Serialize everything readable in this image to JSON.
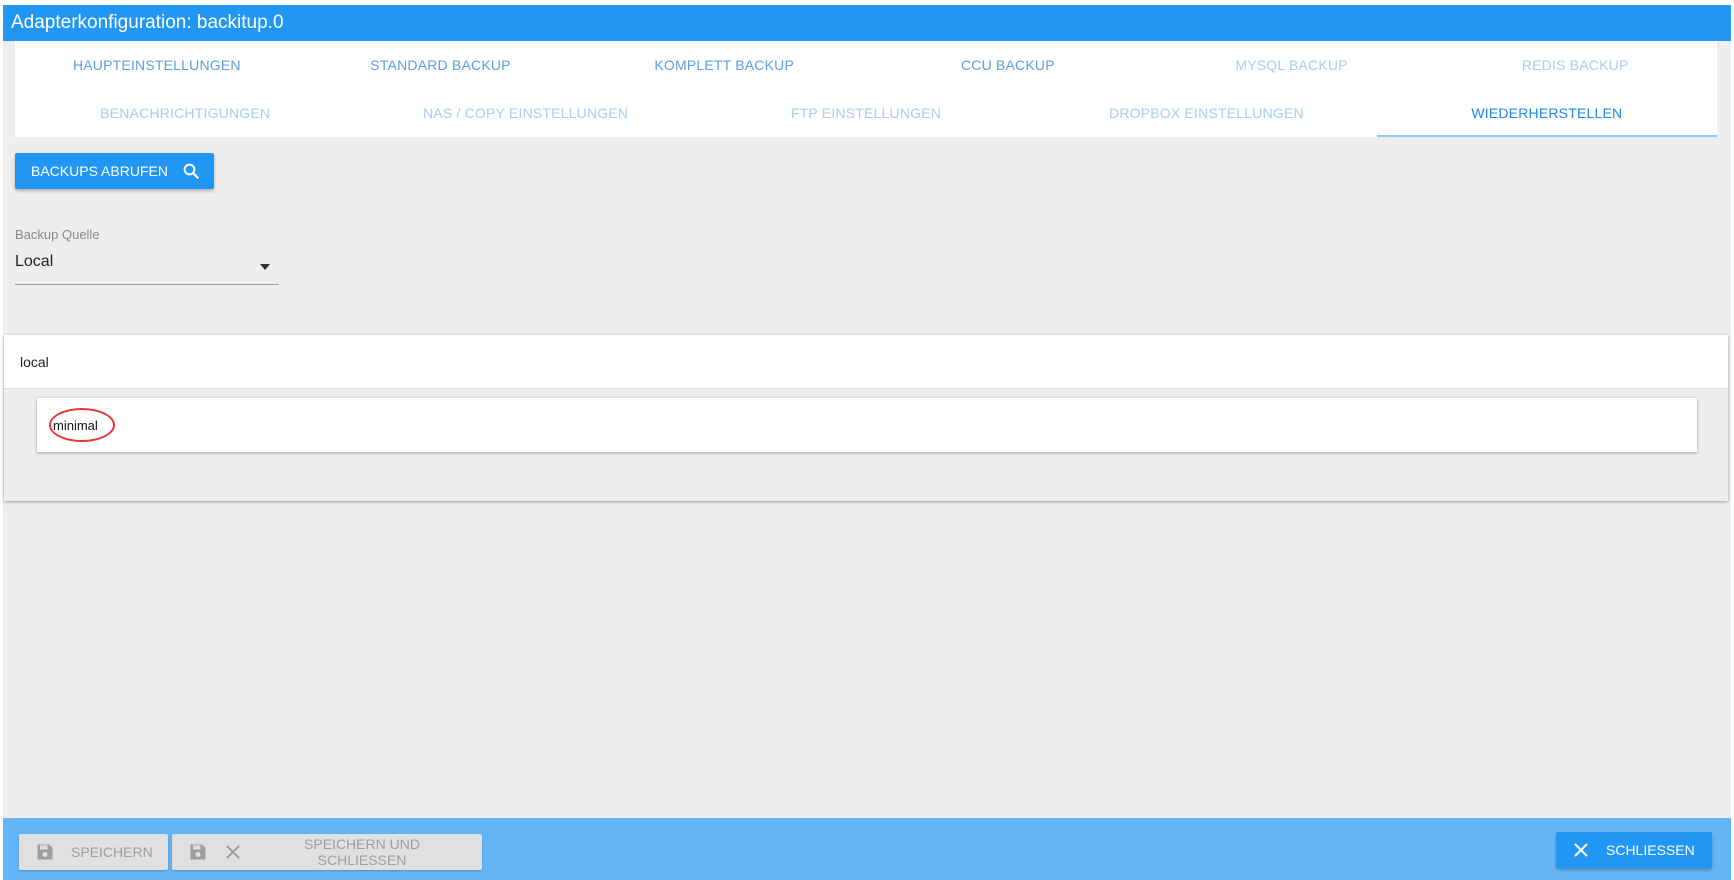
{
  "window": {
    "title": "Adapterkonfiguration: backitup.0"
  },
  "tabs": {
    "row1": [
      {
        "label": "HAUPTEINSTELLUNGEN",
        "state": "normal"
      },
      {
        "label": "STANDARD BACKUP",
        "state": "normal"
      },
      {
        "label": "KOMPLETT BACKUP",
        "state": "normal"
      },
      {
        "label": "CCU BACKUP",
        "state": "normal"
      },
      {
        "label": "MYSQL BACKUP",
        "state": "disabled"
      },
      {
        "label": "REDIS BACKUP",
        "state": "disabled"
      }
    ],
    "row2": [
      {
        "label": "BENACHRICHTIGUNGEN",
        "state": "disabled"
      },
      {
        "label": "NAS / COPY EINSTELLUNGEN",
        "state": "disabled"
      },
      {
        "label": "FTP EINSTELLUNGEN",
        "state": "disabled"
      },
      {
        "label": "DROPBOX EINSTELLUNGEN",
        "state": "disabled"
      },
      {
        "label": "WIEDERHERSTELLEN",
        "state": "active"
      }
    ]
  },
  "restore": {
    "fetch_button_label": "BACKUPS ABRUFEN",
    "fetch_icon": "search-icon",
    "source_label": "Backup Quelle",
    "source_value": "Local",
    "panel_title": "local",
    "backup_items": [
      {
        "label": "minimal"
      }
    ],
    "annotation_color": "#e53935"
  },
  "footer": {
    "save_label": "SPEICHERN",
    "save_close_label": "SPEICHERN UND SCHLIESSEN",
    "close_label": "SCHLIESSEN"
  },
  "colors": {
    "primary": "#2196f3",
    "footer": "#64b5f6",
    "background": "#eeeeee"
  }
}
